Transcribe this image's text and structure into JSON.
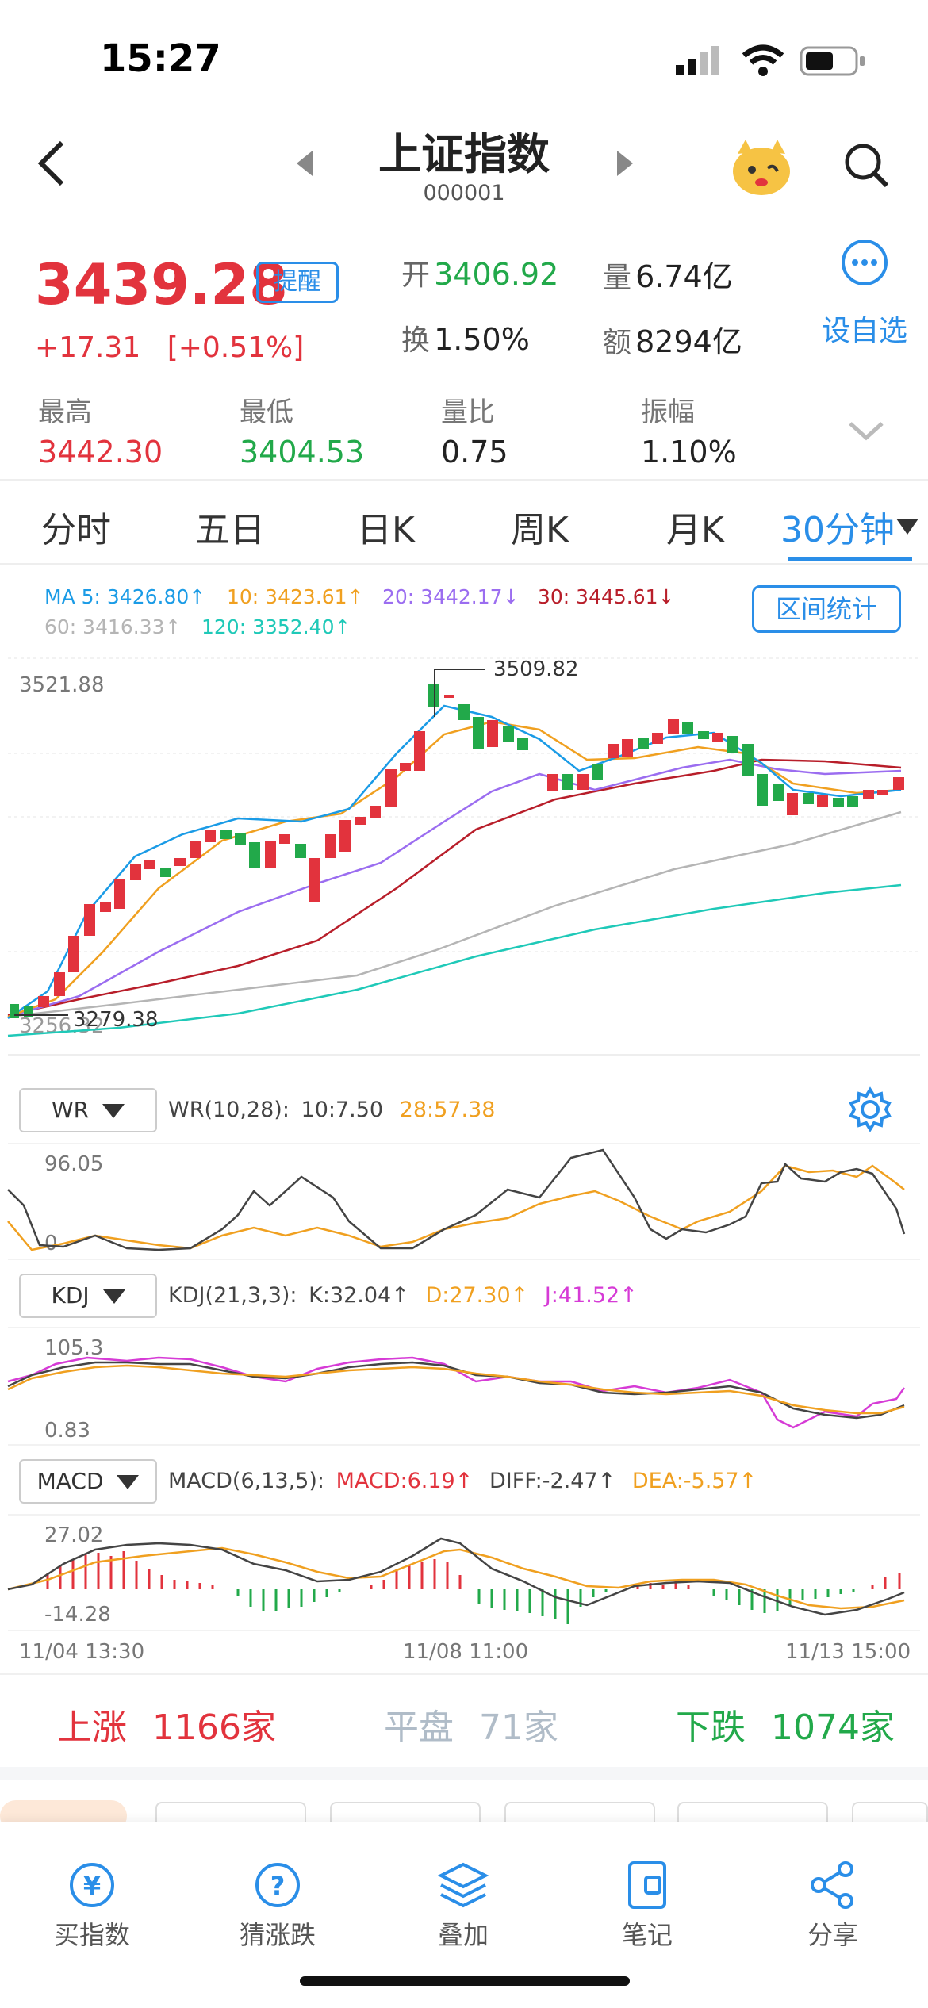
{
  "status": {
    "time": "15:27"
  },
  "header": {
    "title": "上证指数",
    "code": "000001"
  },
  "quote": {
    "price": "3439.28",
    "remind_label": "提醒",
    "change": "+17.31",
    "change_pct": "[+0.51%]",
    "open_label": "开",
    "open": "3406.92",
    "volume_label": "量",
    "volume": "6.74亿",
    "turnover_label": "换",
    "turnover": "1.50%",
    "amount_label": "额",
    "amount": "8294亿",
    "watchlist_label": "设自选",
    "high_label": "最高",
    "high": "3442.30",
    "low_label": "最低",
    "low": "3404.53",
    "vol_ratio_label": "量比",
    "vol_ratio": "0.75",
    "amplitude_label": "振幅",
    "amplitude": "1.10%"
  },
  "tabs": [
    "分时",
    "五日",
    "日K",
    "周K",
    "月K",
    "30分钟"
  ],
  "ma_legend": {
    "ma5": "MA 5: 3426.80↑",
    "ma10": "10: 3423.61↑",
    "ma20": "20: 3442.17↓",
    "ma30": "30: 3445.61↓",
    "ma60": "60: 3416.33↑",
    "ma120": "120: 3352.40↑",
    "range_stat": "区间统计"
  },
  "colors": {
    "up": "#e2333d",
    "down": "#22a94a",
    "ma5": "#1a9be6",
    "ma10": "#f0a020",
    "ma20": "#9b6df0",
    "ma30": "#b81e2a",
    "ma60": "#b5b5b5",
    "ma120": "#1fc9b8",
    "accent": "#2a8ee8"
  },
  "price_chart": {
    "top_label": "3521.88",
    "bottom_label": "3256.32",
    "high_annot": "3509.82",
    "low_annot": "3279.38"
  },
  "wr": {
    "button": "WR",
    "title": "WR(10,28):",
    "v1": "10:7.50",
    "v2": "28:57.38",
    "top": "96.05",
    "bottom": "0"
  },
  "kdj": {
    "button": "KDJ",
    "title": "KDJ(21,3,3):",
    "k": "K:32.04↑",
    "d": "D:27.30↑",
    "j": "J:41.52↑",
    "top": "105.3",
    "bottom": "0.83"
  },
  "macd": {
    "button": "MACD",
    "title": "MACD(6,13,5):",
    "macd": "MACD:6.19↑",
    "diff": "DIFF:-2.47↑",
    "dea": "DEA:-5.57↑",
    "top": "27.02",
    "bottom": "-14.28"
  },
  "time_axis": [
    "11/04 13:30",
    "11/08 11:00",
    "11/13 15:00"
  ],
  "breadth": {
    "up_label": "上涨",
    "up_count": "1166家",
    "flat_label": "平盘",
    "flat_count": "71家",
    "down_label": "下跌",
    "down_count": "1074家"
  },
  "bottom_bar": [
    "买指数",
    "猜涨跌",
    "叠加",
    "笔记",
    "分享"
  ]
}
